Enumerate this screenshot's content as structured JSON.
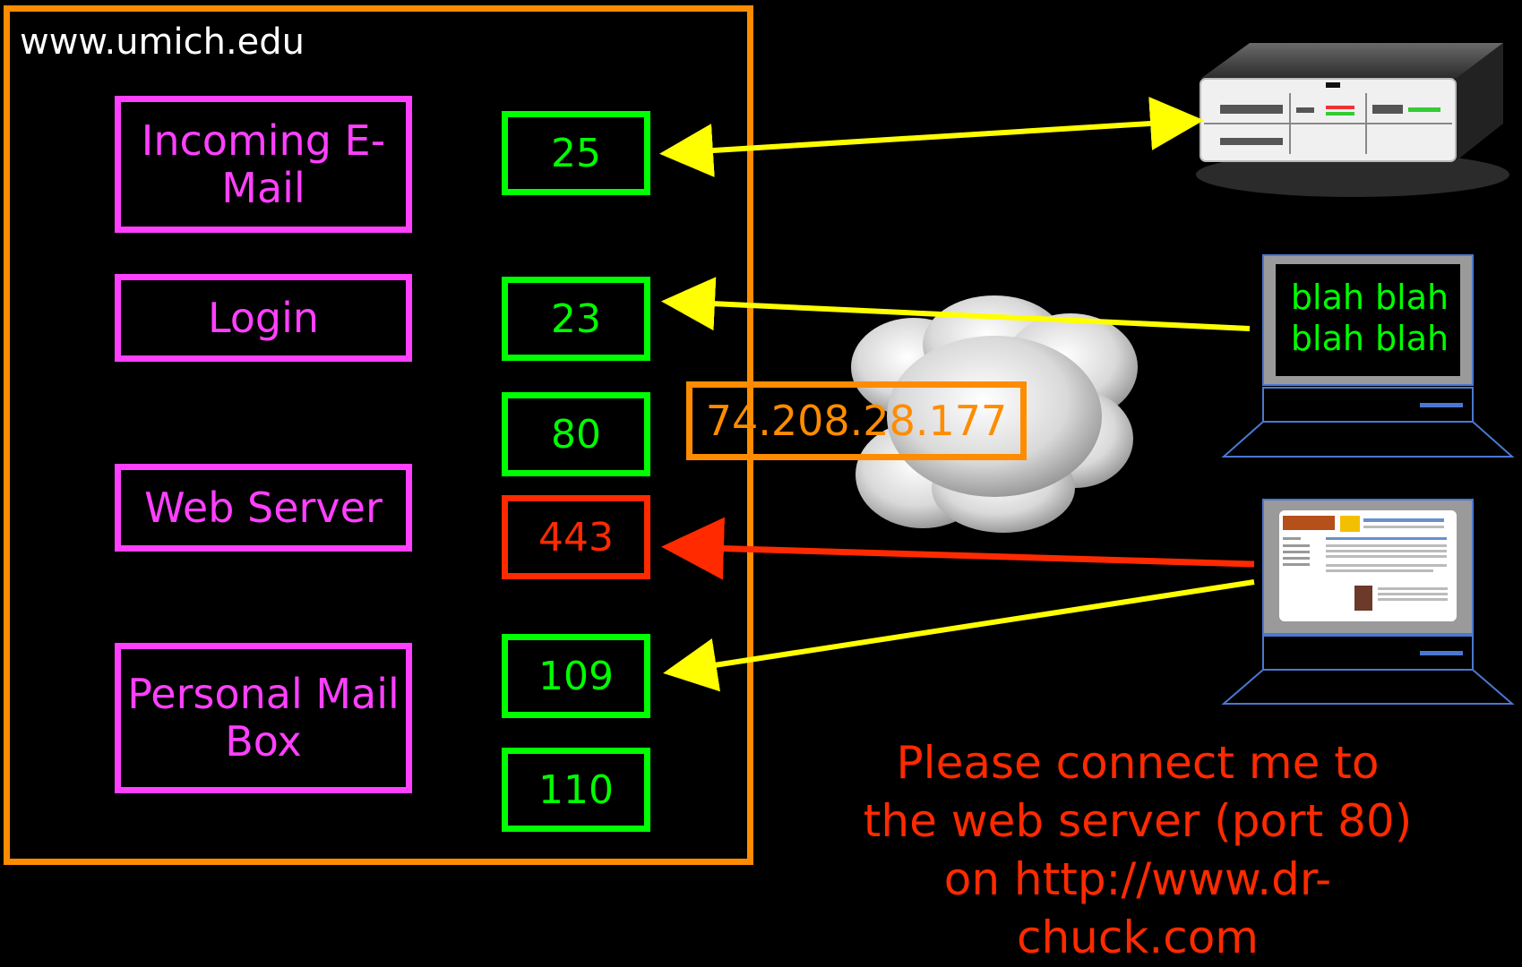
{
  "host": "www.umich.edu",
  "services": {
    "incoming_email": "Incoming E-Mail",
    "login": "Login",
    "web_server": "Web Server",
    "personal_mailbox": "Personal Mail Box"
  },
  "ports": [
    "25",
    "23",
    "80",
    "443",
    "109",
    "110"
  ],
  "ip_address": "74.208.28.177",
  "terminal_text": "blah blah blah blah",
  "request_text": "Please connect me to the web server (port 80) on http://www.dr-chuck.com",
  "colors": {
    "frame": "#ff8c00",
    "service": "#ff40ff",
    "port": "#00ff00",
    "secure_port": "#ff2a00",
    "arrow": "#ffff00",
    "secure_arrow": "#ff2a00"
  }
}
